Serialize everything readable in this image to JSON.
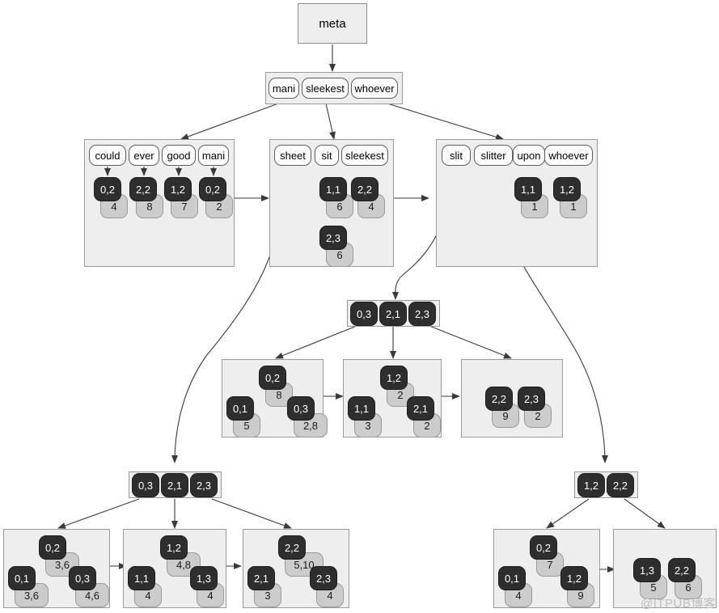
{
  "diagram": {
    "title": "meta",
    "watermark": "@ITPUB博客",
    "colors": {
      "panel_fill": "#eeeeee",
      "panel_stroke": "#9a9a9a",
      "key_fill": "#2e2e2e",
      "key_text": "#ffffff",
      "value_fill": "#cccccc",
      "value_text": "#1a1a1a",
      "word_fill": "#ffffff",
      "edge": "#3a3a3a",
      "background": "#ffffff"
    },
    "root": {
      "label": "meta"
    },
    "level1": {
      "name": "root-index-node",
      "words": [
        "mani",
        "sleekest",
        "whoever"
      ]
    },
    "level2": [
      {
        "name": "leaf-block-1",
        "words": [
          "could",
          "ever",
          "good",
          "mani"
        ],
        "entries": [
          {
            "key": "0,2",
            "value": "4"
          },
          {
            "key": "2,2",
            "value": "8"
          },
          {
            "key": "1,2",
            "value": "7"
          },
          {
            "key": "0,2",
            "value": "2"
          }
        ]
      },
      {
        "name": "leaf-block-2",
        "words": [
          "sheet",
          "sit",
          "sleekest"
        ],
        "entries": [
          {
            "key": "1,1",
            "value": "6"
          },
          {
            "key": "2,2",
            "value": "4"
          },
          {
            "key": "2,3",
            "value": "6"
          }
        ]
      },
      {
        "name": "leaf-block-3",
        "words": [
          "slit",
          "slitter",
          "upon",
          "whoever"
        ],
        "entries": [
          {
            "key": "1,1",
            "value": "1"
          },
          {
            "key": "1,2",
            "value": "1"
          }
        ]
      }
    ],
    "middle_index": {
      "name": "middle-index-node",
      "keys": [
        "0,3",
        "2,1",
        "2,3"
      ]
    },
    "middle_leaves": [
      {
        "name": "middle-leaf-1",
        "entries": [
          {
            "key": "0,2",
            "value": "8"
          },
          {
            "key": "0,1",
            "value": "5"
          },
          {
            "key": "0,3",
            "value": "2,8"
          }
        ]
      },
      {
        "name": "middle-leaf-2",
        "entries": [
          {
            "key": "1,2",
            "value": "2"
          },
          {
            "key": "1,1",
            "value": "3"
          },
          {
            "key": "2,1",
            "value": "2"
          }
        ]
      },
      {
        "name": "middle-leaf-3",
        "entries": [
          {
            "key": "2,2",
            "value": "9"
          },
          {
            "key": "2,3",
            "value": "2"
          }
        ]
      }
    ],
    "bottom_left_index": {
      "name": "bottom-left-index-node",
      "keys": [
        "0,3",
        "2,1",
        "2,3"
      ]
    },
    "bottom_left_leaves": [
      {
        "name": "bottom-left-leaf-1",
        "entries": [
          {
            "key": "0,2",
            "value": "3,6"
          },
          {
            "key": "0,1",
            "value": "3,6"
          },
          {
            "key": "0,3",
            "value": "4,6"
          }
        ]
      },
      {
        "name": "bottom-left-leaf-2",
        "entries": [
          {
            "key": "1,2",
            "value": "4,8"
          },
          {
            "key": "1,1",
            "value": "4"
          },
          {
            "key": "1,3",
            "value": "4"
          }
        ]
      },
      {
        "name": "bottom-left-leaf-3",
        "entries": [
          {
            "key": "2,2",
            "value": "5,10"
          },
          {
            "key": "2,1",
            "value": "3"
          },
          {
            "key": "2,3",
            "value": "4"
          }
        ]
      }
    ],
    "bottom_right_index": {
      "name": "bottom-right-index-node",
      "keys": [
        "1,2",
        "2,2"
      ]
    },
    "bottom_right_leaves": [
      {
        "name": "bottom-right-leaf-1",
        "entries": [
          {
            "key": "0,2",
            "value": "7"
          },
          {
            "key": "0,1",
            "value": "4"
          },
          {
            "key": "1,2",
            "value": "9"
          }
        ]
      },
      {
        "name": "bottom-right-leaf-2",
        "entries": [
          {
            "key": "1,3",
            "value": "5"
          },
          {
            "key": "2,2",
            "value": "6"
          }
        ]
      }
    ]
  }
}
